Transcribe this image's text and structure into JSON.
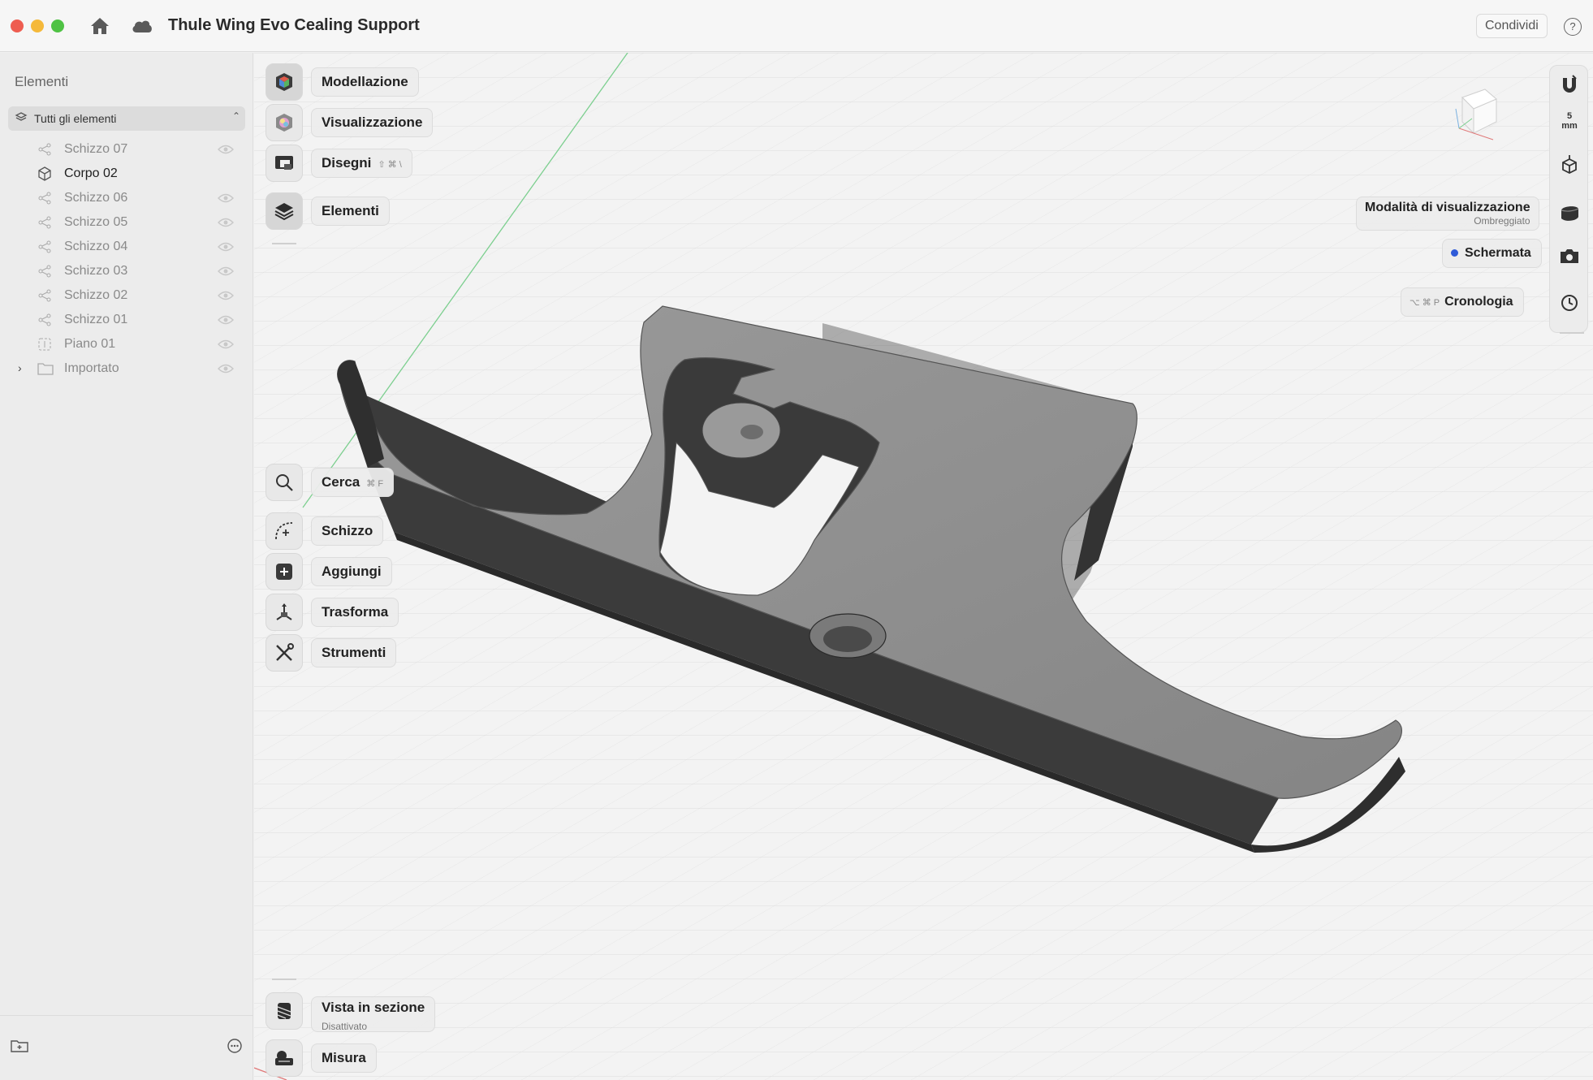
{
  "window": {
    "title": "Thule Wing Evo Cealing Support",
    "share_label": "Condividi",
    "help_label": "?"
  },
  "sidebar": {
    "title": "Elementi",
    "filter_label": "Tutti gli elementi",
    "items": [
      {
        "label": "Schizzo 07",
        "icon": "sketch-icon"
      },
      {
        "label": "Corpo 02",
        "icon": "body-icon"
      },
      {
        "label": "Schizzo 06",
        "icon": "sketch-icon"
      },
      {
        "label": "Schizzo 05",
        "icon": "sketch-icon"
      },
      {
        "label": "Schizzo 04",
        "icon": "sketch-icon"
      },
      {
        "label": "Schizzo 03",
        "icon": "sketch-icon"
      },
      {
        "label": "Schizzo 02",
        "icon": "sketch-icon"
      },
      {
        "label": "Schizzo 01",
        "icon": "sketch-icon"
      },
      {
        "label": "Piano 01",
        "icon": "plane-icon"
      },
      {
        "label": "Importato",
        "icon": "folder-icon"
      }
    ]
  },
  "left_toolbar": {
    "modellazione": "Modellazione",
    "visualizzazione": "Visualizzazione",
    "disegni": "Disegni",
    "disegni_shortcut": "⇧ ⌘ \\",
    "elementi": "Elementi",
    "cerca": "Cerca",
    "cerca_shortcut": "⌘ F",
    "schizzo": "Schizzo",
    "aggiungi": "Aggiungi",
    "trasforma": "Trasforma",
    "strumenti": "Strumenti",
    "vista_sezione": "Vista in sezione",
    "vista_sezione_state": "Disattivato",
    "misura": "Misura"
  },
  "right_toolbar": {
    "scale_value": "5",
    "scale_unit": "mm",
    "view_mode_label": "Modalità di visualizzazione",
    "view_mode_value": "Ombreggiato",
    "screenshot_label": "Schermata",
    "history_label": "Cronologia",
    "history_shortcut": "⌥ ⌘ P"
  },
  "colors": {
    "accent": "#2f5bd8",
    "model_top": "#8e8e8e",
    "model_side": "#3a3a3a",
    "grid_line": "#dcdcdc"
  }
}
